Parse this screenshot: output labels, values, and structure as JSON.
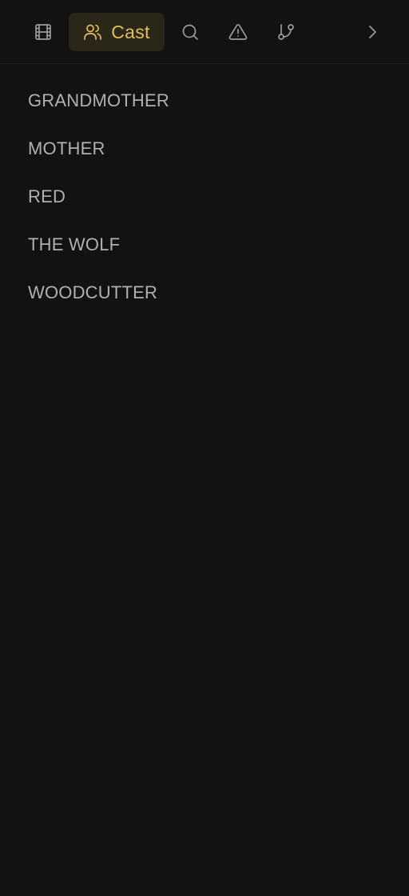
{
  "toolbar": {
    "tabs": [
      {
        "icon": "film-icon"
      },
      {
        "icon": "users-icon",
        "label": "Cast",
        "active": true
      },
      {
        "icon": "search-icon"
      },
      {
        "icon": "warning-icon"
      },
      {
        "icon": "git-branch-icon"
      }
    ],
    "more_icon": "chevron-right-icon",
    "accent_color": "#e2bd58"
  },
  "cast": {
    "items": [
      "GRANDMOTHER",
      "MOTHER",
      "RED",
      "THE WOLF",
      "WOODCUTTER"
    ]
  }
}
